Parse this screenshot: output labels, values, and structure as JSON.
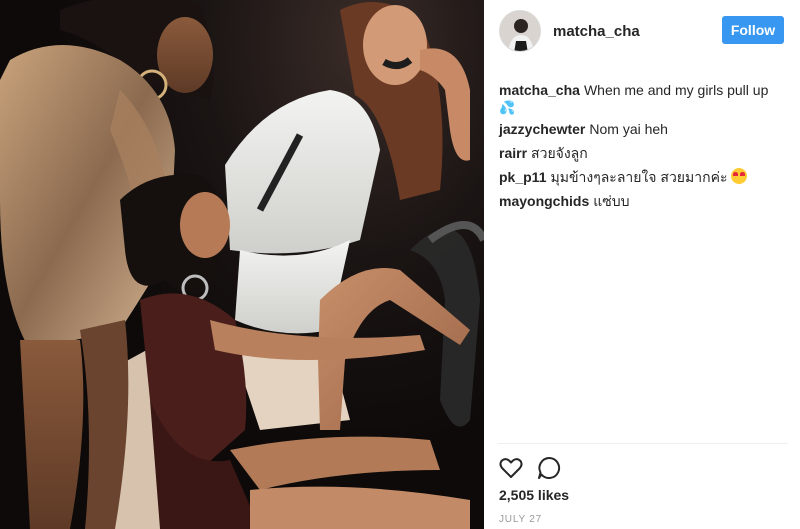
{
  "post": {
    "photo_icon": "photo",
    "author": {
      "username": "matcha_cha",
      "avatar_icon": "avatar"
    },
    "follow_label": "Follow",
    "caption": {
      "user": "matcha_cha",
      "text": "When me and my girls pull up",
      "emoji": "💦"
    },
    "comments": [
      {
        "user": "jazzychewter",
        "text": "Nom yai heh"
      },
      {
        "user": "rairr",
        "text": "สวยจังลูก"
      },
      {
        "user": "pk_p11",
        "text": "มุมข้างๆละลายใจ สวยมากค่ะ",
        "emoji_icon": "heart-eyes-emoji"
      },
      {
        "user": "mayongchids",
        "text": "แซ่บบ"
      }
    ],
    "actions": {
      "like_icon": "heart-icon",
      "comment_icon": "comment-icon"
    },
    "likes": "2,505 likes",
    "date": "JULY 27"
  },
  "colors": {
    "accent": "#3897f0",
    "text": "#262626",
    "muted": "#999999"
  }
}
